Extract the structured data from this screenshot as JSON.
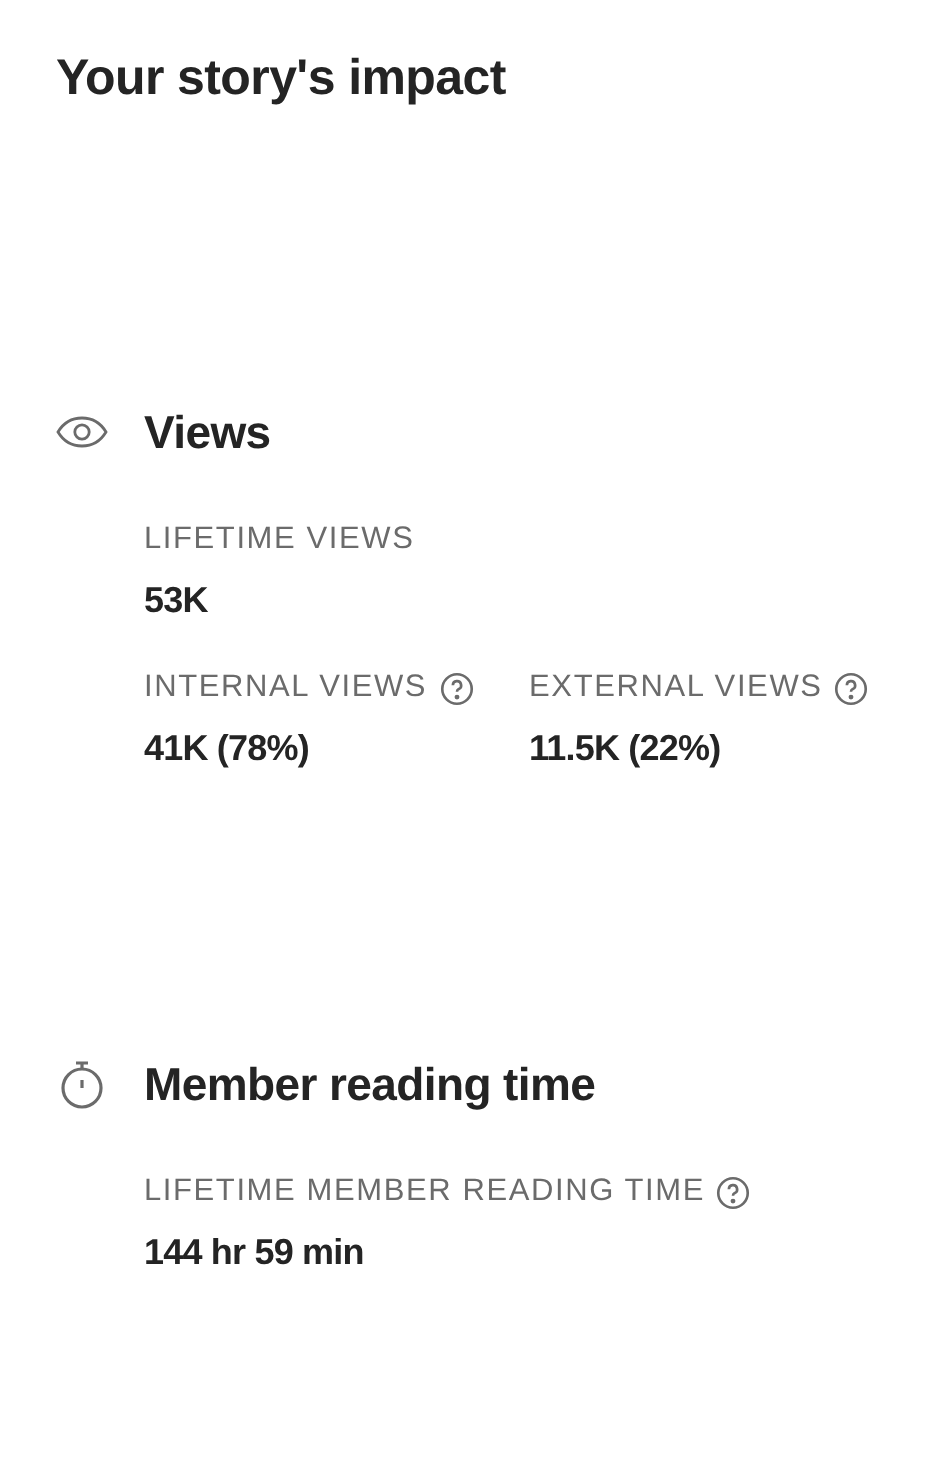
{
  "title": "Your story's impact",
  "sections": [
    {
      "kind": "views",
      "title": "Views",
      "rows": [
        [
          {
            "label": "LIFETIME VIEWS",
            "value": "53K",
            "help": false
          }
        ],
        [
          {
            "label": "INTERNAL VIEWS",
            "value": "41K (78%)",
            "help": true
          },
          {
            "label": "EXTERNAL VIEWS",
            "value": "11.5K (22%)",
            "help": true
          }
        ]
      ]
    },
    {
      "kind": "time",
      "title": "Member reading time",
      "rows": [
        [
          {
            "label": "LIFETIME MEMBER READING TIME",
            "value": "144 hr 59 min",
            "help": true
          }
        ]
      ]
    }
  ]
}
